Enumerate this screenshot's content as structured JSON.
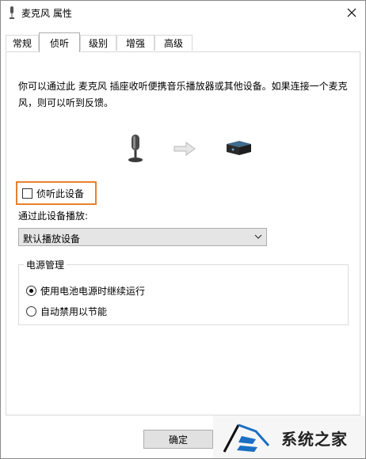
{
  "window": {
    "title": "麦克风 属性",
    "title_icon": "microphone-icon",
    "close_icon": "close-icon"
  },
  "tabs": [
    {
      "label": "常规",
      "active": false
    },
    {
      "label": "侦听",
      "active": true
    },
    {
      "label": "级别",
      "active": false
    },
    {
      "label": "增强",
      "active": false
    },
    {
      "label": "高级",
      "active": false
    }
  ],
  "listen": {
    "description": "你可以通过此 麦克风 插座收听便携音乐播放器或其他设备。如果连接一个麦克风，则可以听到反馈。",
    "device_icons": [
      "microphone-icon",
      "arrow-right-icon",
      "speaker-device-icon"
    ],
    "listen_checkbox": {
      "label": "侦听此设备",
      "checked": false
    },
    "playback_label": "通过此设备播放:",
    "playback_select": {
      "value": "默认播放设备"
    },
    "power": {
      "title": "电源管理",
      "options": [
        {
          "label": "使用电池电源时继续运行",
          "selected": true
        },
        {
          "label": "自动禁用以节能",
          "selected": false
        }
      ]
    }
  },
  "footer": {
    "ok_label": "确定"
  },
  "watermark": {
    "text": "系统之家"
  },
  "colors": {
    "highlight": "#e8812c",
    "window_border": "#8a8a8a"
  }
}
